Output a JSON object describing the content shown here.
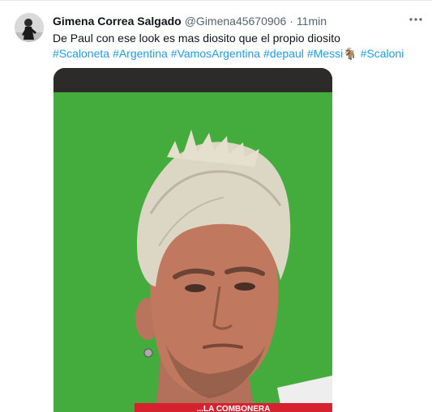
{
  "tweet": {
    "display_name": "Gimena Correa Salgado",
    "handle": "@Gimena45670906",
    "separator": "·",
    "time": "11min",
    "text_line": "De Paul con ese look es mas diosito que el propio diosito",
    "hashtags": [
      "#Scaloneta",
      "#Argentina",
      "#VamosArgentina",
      "#depaul",
      "#Messi🐐",
      "#Scaloni"
    ],
    "media": {
      "banner_text": "...LA COMBONERA"
    }
  },
  "icons": {
    "more": "more-horizontal-icon"
  },
  "colors": {
    "link": "#1d9bf0",
    "text": "#0f1419",
    "muted": "#536471",
    "pitch_green": "#3fa83a",
    "hair_blond": "#dcd6c4"
  }
}
